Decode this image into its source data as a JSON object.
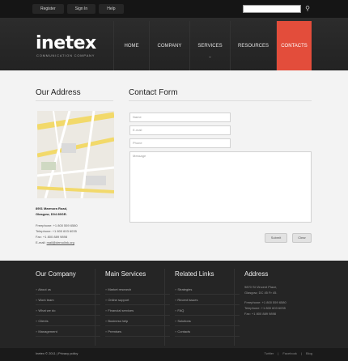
{
  "topbar": {
    "links": [
      "Register",
      "Sign In",
      "Help"
    ],
    "search_placeholder": "",
    "search_icon": "search-icon"
  },
  "header": {
    "logo": "inetex",
    "logo_sub": "COMMUNICATION COMPANY",
    "nav": [
      "HOME",
      "COMPANY",
      "SERVICES",
      "RESOURCES",
      "CONTACTS"
    ],
    "active_nav": "CONTACTS",
    "accent": "#e34d3b"
  },
  "address": {
    "title": "Our Address",
    "street": "8901 Marmora Road,",
    "city": "Glasgow, D04 89GR.",
    "freephone": "Freephone:",
    "freephone_val": "+1 800 559 6580",
    "telephone": "Telephone:",
    "telephone_val": "+1 800 603 6035",
    "fax": "Fax:",
    "fax_val": "+1 800 889 9898",
    "email": "E-mail:",
    "email_val": "mail@demolink.org"
  },
  "form": {
    "title": "Contact Form",
    "name_placeholder": "Name",
    "email_placeholder": "E-mail",
    "phone_placeholder": "Phone",
    "message_placeholder": "Message",
    "submit": "Submit",
    "clear": "Clear"
  },
  "footer": {
    "company": {
      "title": "Our Company",
      "items": [
        "About us",
        "Work team",
        "What we do",
        "Clients",
        "Management"
      ]
    },
    "services": {
      "title": "Main Services",
      "items": [
        "Market research",
        "Online support",
        "Financial services",
        "Business help",
        "Premises"
      ]
    },
    "links": {
      "title": "Related Links",
      "items": [
        "Strategies",
        "Recent issues",
        "FAQ",
        "Solutions",
        "Contacts"
      ]
    },
    "address": {
      "title": "Address",
      "line1": "9870 St Vincent Place,",
      "line2": "Glasgow, DC 45 Fr 45.",
      "freephone": "Freephone:  +1 800 559 6580",
      "telephone": "Telephone:  +1 800 603 6035",
      "fax": "Fax:           +1 800 889 9898"
    }
  },
  "bottom": {
    "copyright": "Inetex © 2011",
    "separator": "|",
    "privacy": "Privacy policy",
    "social": [
      "Twitter",
      "|",
      "Facebook",
      "|",
      "Blog"
    ]
  }
}
